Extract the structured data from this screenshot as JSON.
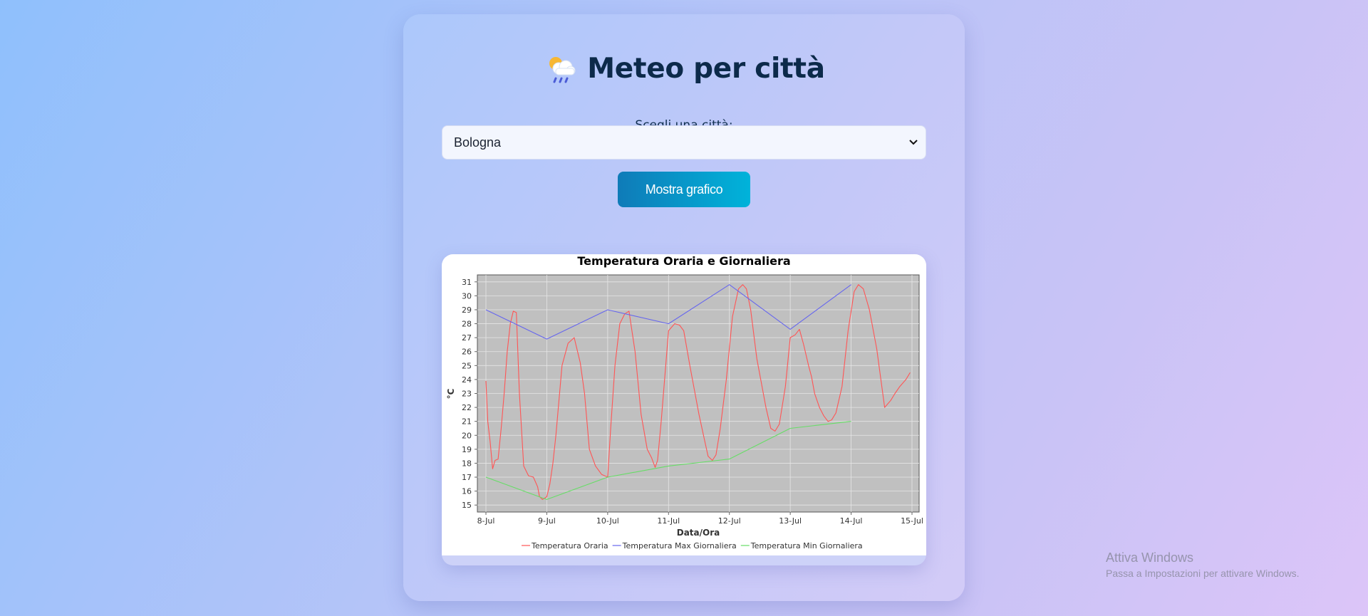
{
  "header": {
    "title": "Meteo per città",
    "emoji_icon": "sun-cloud-rain-icon"
  },
  "city_select": {
    "label": "Scegli una città:",
    "value": "Bologna"
  },
  "show_button": {
    "label": "Mostra grafico"
  },
  "chart_data": {
    "type": "line",
    "title": "Temperatura Oraria e Giornaliera",
    "xlabel": "Data/Ora",
    "ylabel": "°C",
    "x_ticks": [
      "8-Jul",
      "9-Jul",
      "10-Jul",
      "11-Jul",
      "12-Jul",
      "13-Jul",
      "14-Jul",
      "15-Jul"
    ],
    "xlim": [
      0,
      7
    ],
    "ylim": [
      14.5,
      31.5
    ],
    "y_ticks": [
      15,
      16,
      17,
      18,
      19,
      20,
      21,
      22,
      23,
      24,
      25,
      26,
      27,
      28,
      29,
      30,
      31
    ],
    "grid": true,
    "legend_position": "bottom",
    "series": [
      {
        "name": "Temperatura Oraria",
        "color": "#ff5555",
        "x": [
          0.0,
          0.03,
          0.07,
          0.11,
          0.15,
          0.2,
          0.25,
          0.3,
          0.35,
          0.4,
          0.45,
          0.5,
          0.55,
          0.62,
          0.7,
          0.78,
          0.85,
          0.88,
          0.93,
          1.0,
          1.05,
          1.1,
          1.15,
          1.25,
          1.35,
          1.45,
          1.55,
          1.62,
          1.7,
          1.8,
          1.9,
          2.0,
          2.05,
          2.12,
          2.2,
          2.28,
          2.35,
          2.45,
          2.55,
          2.65,
          2.72,
          2.78,
          2.82,
          2.88,
          3.0,
          3.1,
          3.18,
          3.25,
          3.35,
          3.5,
          3.6,
          3.65,
          3.72,
          3.78,
          3.85,
          3.95,
          4.05,
          4.15,
          4.22,
          4.28,
          4.35,
          4.45,
          4.6,
          4.68,
          4.75,
          4.82,
          4.92,
          5.0,
          5.08,
          5.15,
          5.22,
          5.3,
          5.35,
          5.4,
          5.48,
          5.55,
          5.62,
          5.68,
          5.75,
          5.85,
          5.95,
          6.05,
          6.12,
          6.2,
          6.3,
          6.42,
          6.55,
          6.65,
          6.72,
          6.8,
          6.9,
          6.97
        ],
        "y": [
          23.9,
          21.0,
          19.5,
          17.6,
          18.2,
          18.3,
          20.5,
          23.0,
          26.0,
          28.0,
          28.9,
          28.8,
          23.0,
          17.8,
          17.1,
          17.0,
          16.3,
          15.6,
          15.4,
          15.6,
          16.5,
          18.0,
          20.0,
          25.0,
          26.6,
          27.0,
          25.2,
          23.0,
          19.0,
          17.8,
          17.2,
          17.0,
          20.5,
          25.0,
          28.0,
          28.7,
          28.9,
          26.0,
          21.5,
          19.0,
          18.4,
          17.7,
          18.2,
          21.0,
          27.5,
          28.0,
          27.9,
          27.5,
          25.0,
          21.5,
          19.5,
          18.5,
          18.2,
          18.6,
          20.5,
          24.0,
          28.5,
          30.5,
          30.8,
          30.5,
          29.0,
          25.5,
          22.0,
          20.5,
          20.3,
          20.8,
          23.5,
          27.0,
          27.2,
          27.6,
          26.5,
          25.0,
          24.2,
          23.0,
          22.0,
          21.4,
          21.0,
          21.1,
          21.6,
          23.5,
          27.5,
          30.3,
          30.8,
          30.5,
          29.0,
          26.2,
          22.0,
          22.5,
          23.0,
          23.5,
          24.0,
          24.5
        ],
        "y_note": "approximate read-off"
      },
      {
        "name": "Temperatura Max Giornaliera",
        "color": "#6666ee",
        "x": [
          0,
          1,
          2,
          3,
          4,
          5,
          6
        ],
        "y": [
          29.0,
          26.9,
          29.0,
          28.0,
          30.8,
          27.6,
          30.8
        ]
      },
      {
        "name": "Temperatura Min Giornaliera",
        "color": "#66dd66",
        "x": [
          0,
          1,
          2,
          3,
          4,
          5,
          6
        ],
        "y": [
          17.0,
          15.4,
          17.0,
          17.8,
          18.3,
          20.5,
          21.0
        ]
      }
    ]
  },
  "watermark": {
    "line1": "Attiva Windows",
    "line2": "Passa a Impostazioni per attivare Windows."
  }
}
